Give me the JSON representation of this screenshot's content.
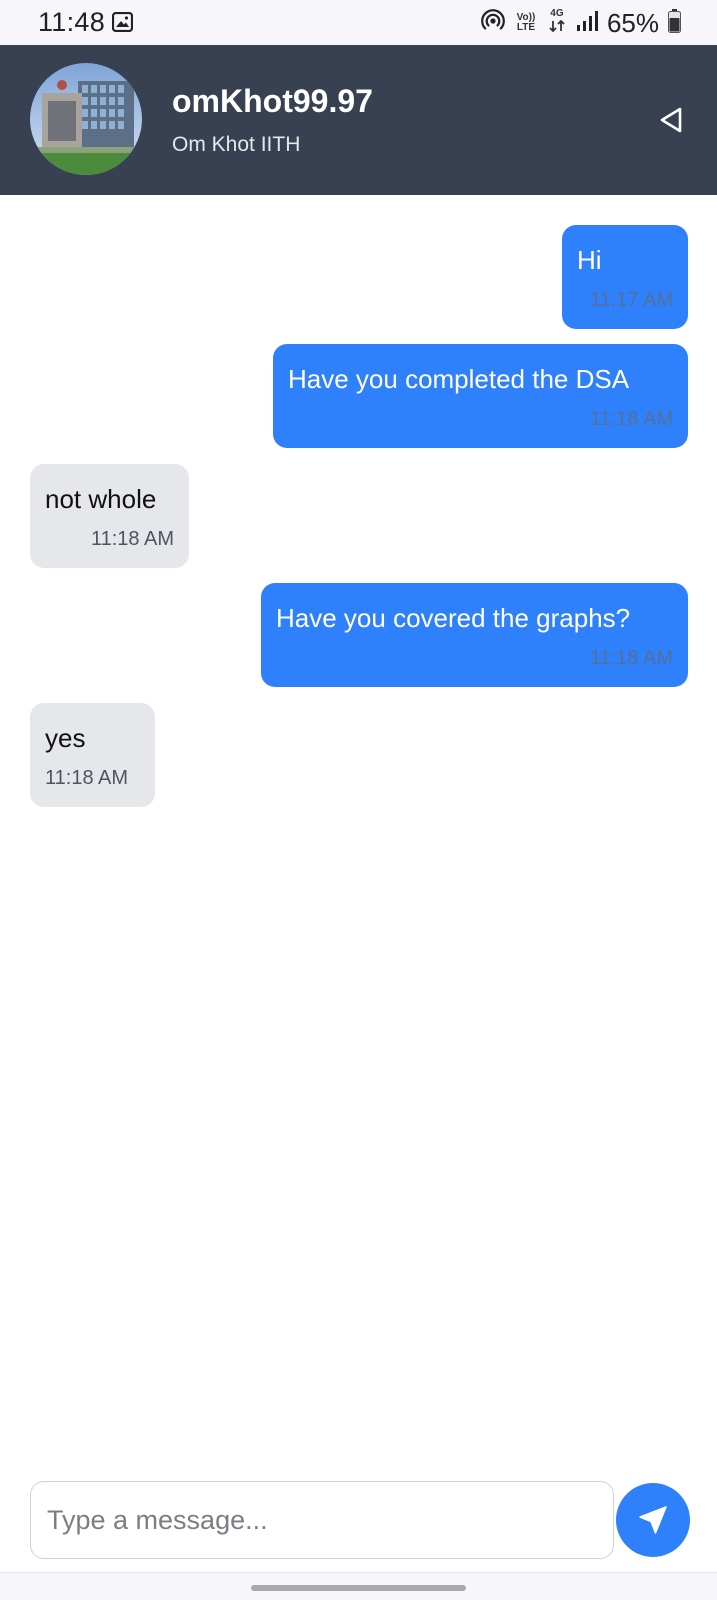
{
  "status_bar": {
    "time": "11:48",
    "network_type": "4G",
    "volte_top": "Vo))",
    "volte_bottom": "LTE",
    "battery": "65%",
    "icons": [
      "gallery-icon",
      "hotspot-icon",
      "volte-icon",
      "4g-icon",
      "signal-icon",
      "battery-icon"
    ]
  },
  "header": {
    "name": "omKhot99.97",
    "subtitle": "Om Khot IITH",
    "avatar_icon": "building-photo",
    "action_icon": "triangle-back-icon",
    "background": "#374151"
  },
  "messages": [
    {
      "direction": "sent",
      "text": "Hi",
      "time": "11:17 AM"
    },
    {
      "direction": "sent",
      "text": "Have you completed the DSA",
      "time": "11:18 AM"
    },
    {
      "direction": "received",
      "text": "not whole",
      "time": "11:18 AM"
    },
    {
      "direction": "sent",
      "text": "Have you covered the graphs?",
      "time": "11:18 AM"
    },
    {
      "direction": "received",
      "text": "yes",
      "time": "11:18 AM"
    }
  ],
  "composer": {
    "placeholder": "Type a message...",
    "send_icon": "send-arrow-icon"
  },
  "colors": {
    "sent_bubble": "#2f80fb",
    "received_bubble": "#e6e7eb",
    "header": "#374151"
  }
}
